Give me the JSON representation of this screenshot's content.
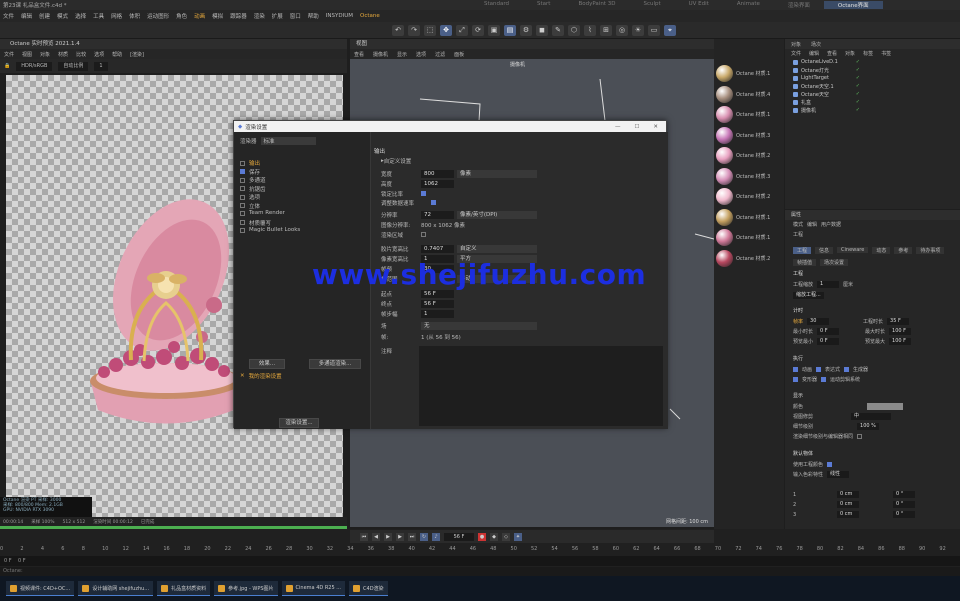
{
  "window": {
    "title": "第23课 礼品盒文件.c4d *"
  },
  "workspaces": [
    "Standard",
    "Start",
    "BodyPaint 3D",
    "Sculpt",
    "UV Edit",
    "Animate",
    "渲染界面",
    "Octane界面"
  ],
  "workspace_active": "Octane界面",
  "menu": [
    "文件",
    "编辑",
    "创建",
    "模式",
    "选择",
    "工具",
    "网格",
    "体积",
    "运动图形",
    "角色",
    "动画",
    "模拟",
    "跟踪器",
    "渲染",
    "扩展",
    "窗口",
    "帮助",
    "INSYDIUM",
    "Octane"
  ],
  "toolbar_icons": [
    "undo-icon",
    "redo-icon",
    "select-icon",
    "move-icon",
    "scale-icon",
    "rotate-icon",
    "render-icon",
    "render-view-icon",
    "render-settings-icon",
    "cube-icon",
    "pen-icon",
    "subdivide-icon",
    "deformer-icon",
    "scene-icon",
    "camera-icon",
    "light-icon",
    "floor-icon",
    "snap-icon"
  ],
  "picture_viewer": {
    "title": "Octane 实时预览 2021.1.4",
    "menu": [
      "文件",
      "视图",
      "对象",
      "材质",
      "比较",
      "选项",
      "帮助",
      "[渲染]"
    ],
    "tools": {
      "mode": "HDR/sRGB",
      "zoom": "1",
      "auto": "自动比例"
    },
    "status_lines": [
      "Octane 渲染 PT 采样: 3000",
      "采样: 800/800  Mem: 2.1GB",
      "GPU: NVIDIA RTX 3090"
    ],
    "bottom": [
      "00:00:14",
      "采样 100%",
      "512 x 512",
      "渲染时间 00:00:12",
      "已完成"
    ]
  },
  "viewport": {
    "title": "视图",
    "menu": [
      "查看",
      "摄像机",
      "显示",
      "选项",
      "过滤",
      "面板"
    ],
    "camera_label": "摄像机",
    "grid_label": "网格间距: 100 cm"
  },
  "materials": [
    {
      "name": "Octane 材质.1",
      "color": "#c9a96a"
    },
    {
      "name": "Octane 材质.4",
      "color": "#a89080"
    },
    {
      "name": "Octane 材质.1",
      "color": "#d88fb0"
    },
    {
      "name": "Octane 材质.3",
      "color": "#c878b8"
    },
    {
      "name": "Octane 材质.2",
      "color": "#e8a0c0"
    },
    {
      "name": "Octane 材质.3",
      "color": "#d690b8"
    },
    {
      "name": "Octane 材质.2",
      "color": "#f0b8cc"
    },
    {
      "name": "Octane 材质.1",
      "color": "#c4a060"
    },
    {
      "name": "Octane 材质.1",
      "color": "#d07898"
    },
    {
      "name": "Octane 材质.2",
      "color": "#b84860"
    }
  ],
  "objects": {
    "tabs": [
      "对象",
      "场次"
    ],
    "menu": [
      "文件",
      "编辑",
      "查看",
      "对象",
      "标签",
      "书签"
    ],
    "rows": [
      "OctaneLiveD.1",
      "Octane灯光",
      "LightTarget",
      "Octane天空.1",
      "Octane天空",
      "礼盒",
      "摄像机"
    ]
  },
  "attributes": {
    "title": "属性",
    "menu": [
      "模式",
      "编辑",
      "用户数据"
    ],
    "section": "工程",
    "tabs": [
      "工程",
      "信息",
      "Cineware",
      "动态",
      "参考",
      "待办事项",
      "帧插值",
      "场次设置"
    ],
    "fields": {
      "project_scale_label": "工程缩放",
      "project_scale": "1",
      "project_unit": "厘米",
      "scale_project": "缩放工程...",
      "timing": "计时",
      "fps_label": "帧率",
      "fps": "30",
      "project_time_label": "工程时长",
      "project_time": "35 F",
      "min_time_label": "最小时长",
      "min_time": "0 F",
      "max_time_label": "最大时长",
      "max_time": "100 F",
      "preview_min_label": "预览最小",
      "preview_min": "0 F",
      "preview_max_label": "预览最大",
      "preview_max": "100 F",
      "execute": "执行",
      "animation": "动画",
      "expression": "表达式",
      "generator": "生成器",
      "deformer": "变形器",
      "motion": "运动剪辑系统",
      "display": "显示",
      "color_label": "颜色",
      "viewport_clip": "视图修剪",
      "clip_val": "中",
      "lod_label": "细节级别",
      "lod": "100 %",
      "render_lod": "渲染细节级别与编辑器相同",
      "default_obj": "默认物体",
      "use_color": "使用工程颜色",
      "input_color": "输入色彩特性",
      "linear": "线性",
      "weights": [
        "0 cm",
        "0 cm",
        "0 cm"
      ],
      "angles": [
        "0 °",
        "0 °",
        "0 °"
      ]
    }
  },
  "dialog": {
    "title": "渲染设置",
    "renderer_label": "渲染器",
    "renderer": "标准",
    "left_items": [
      "输出",
      "保存",
      "多通道",
      "抗锯齿",
      "选项",
      "立体",
      "Team Render",
      "材质覆写",
      "Magic Bullet Looks"
    ],
    "left_checked": [
      false,
      true,
      false,
      false,
      false,
      false,
      false,
      false,
      false
    ],
    "effect_btn": "效果...",
    "multipass_btn": "多通道渲染...",
    "render_setting": "我的渲染设置",
    "render_setting_btn": "渲染设置...",
    "section": "输出",
    "preset_label": "自定义设置",
    "width_label": "宽度",
    "width": "800",
    "width_unit": "像素",
    "height_label": "高度",
    "height": "1062",
    "lock_ratio": "锁定比率",
    "adapt": "调整数据速率",
    "dpi_label": "分辨率",
    "dpi": "72",
    "dpi_unit": "像素/英寸(DPI)",
    "size_label": "图像分辨率:",
    "size": "800 x 1062 像素",
    "region_label": "渲染区域",
    "aspect_label": "胶片宽高比",
    "aspect": "0.7407",
    "aspect_mode": "自定义",
    "pixel_label": "像素宽高比",
    "pixel": "1",
    "pixel_mode": "平方",
    "fps_label": "帧频",
    "fps": "30",
    "range_label": "帧范围",
    "range_mode": "手动",
    "from_label": "起点",
    "from": "56 F",
    "to_label": "终点",
    "to": "56 F",
    "step_label": "帧步幅",
    "step": "1",
    "fields_label": "场",
    "fields": "无",
    "frames_label": "帧:",
    "frames": "1 (从 56 到 56)",
    "notes_label": "注释"
  },
  "watermark": "www.shejifuzhu.com",
  "timeline": {
    "ticks": [
      "0",
      "2",
      "4",
      "6",
      "8",
      "10",
      "12",
      "14",
      "16",
      "18",
      "20",
      "22",
      "24",
      "26",
      "28",
      "30",
      "32",
      "34",
      "36",
      "38",
      "40",
      "42",
      "44",
      "46",
      "48",
      "50",
      "52",
      "54",
      "56",
      "58",
      "60",
      "62",
      "64",
      "66",
      "68",
      "70",
      "72",
      "74",
      "76",
      "78",
      "80",
      "82",
      "84",
      "86",
      "88",
      "90",
      "92"
    ],
    "current_frame": "56 F",
    "range_start": "0 F",
    "range_end": "0 F"
  },
  "status_text": "Octane:",
  "taskbar": [
    "视频课件: C4D+OC...",
    "设计辅助网 shejifuzhu...",
    "礼品盒材质资料",
    "参考.jpg - WPS图片",
    "Cinema 4D R25 ...",
    "C4D渲染"
  ]
}
